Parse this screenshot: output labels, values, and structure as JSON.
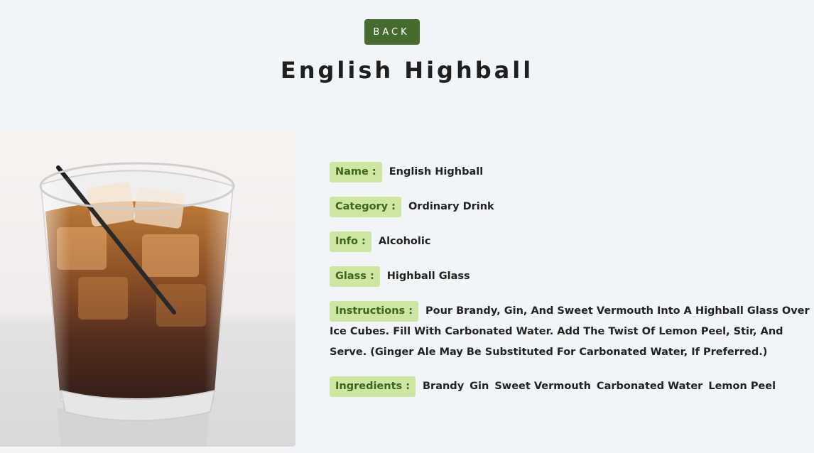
{
  "back_button": {
    "label": "BACK"
  },
  "page_title": "English Highball",
  "details": {
    "name": {
      "label": "Name :",
      "value": "English Highball"
    },
    "category": {
      "label": "Category :",
      "value": "Ordinary Drink"
    },
    "info": {
      "label": "Info :",
      "value": "Alcoholic"
    },
    "glass": {
      "label": "Glass :",
      "value": "Highball Glass"
    },
    "instructions": {
      "label": "Instructions :",
      "value": "Pour Brandy, Gin, And Sweet Vermouth Into A Highball Glass Over Ice Cubes. Fill With Carbonated Water. Add The Twist Of Lemon Peel, Stir, And Serve. (Ginger Ale May Be Substituted For Carbonated Water, If Preferred.)"
    },
    "ingredients": {
      "label": "Ingredients :",
      "items": [
        "Brandy",
        "Gin",
        "Sweet Vermouth",
        "Carbonated Water",
        "Lemon Peel"
      ]
    }
  },
  "colors": {
    "background": "#f1f5f8",
    "button": "#476a2e",
    "label_bg": "#cde6a2",
    "label_text": "#3e6423"
  }
}
